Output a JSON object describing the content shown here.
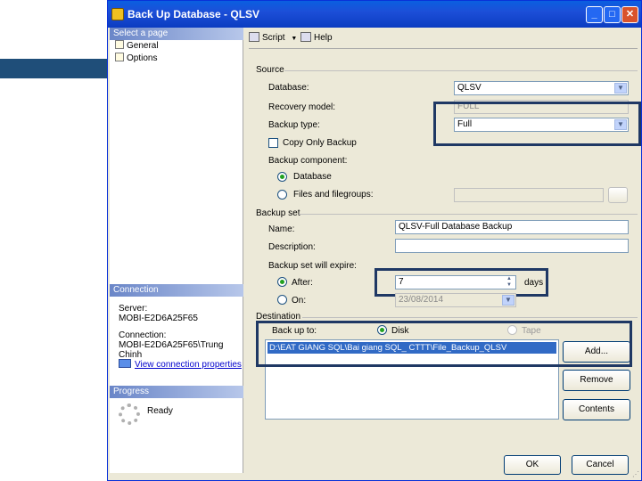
{
  "window": {
    "title": "Back Up Database - QLSV",
    "min_glyph": "_",
    "max_glyph": "□",
    "close_glyph": "✕"
  },
  "leftpanel": {
    "select_page": "Select a page",
    "pages": [
      "General",
      "Options"
    ],
    "connection_header": "Connection",
    "server_label": "Server:",
    "server_value": "MOBI-E2D6A25F65",
    "connection_label": "Connection:",
    "connection_value": "MOBI-E2D6A25F65\\Trung Chinh",
    "view_link": "View connection properties",
    "progress_header": "Progress",
    "progress_status": "Ready"
  },
  "toolbar": {
    "script": "Script",
    "script_caret": "▼",
    "help": "Help"
  },
  "source": {
    "heading": "Source",
    "database_label": "Database:",
    "database_value": "QLSV",
    "recovery_label": "Recovery model:",
    "recovery_value": "FULL",
    "backup_type_label": "Backup type:",
    "backup_type_value": "Full",
    "copy_only_label": "Copy Only Backup",
    "component_label": "Backup component:",
    "component_database": "Database",
    "component_files": "Files and filegroups:"
  },
  "backup_set": {
    "heading": "Backup set",
    "name_label": "Name:",
    "name_value": "QLSV-Full Database Backup",
    "description_label": "Description:",
    "description_value": "",
    "expire_label": "Backup set will expire:",
    "after_label": "After:",
    "after_value": "7",
    "after_unit": "days",
    "on_label": "On:",
    "on_value": "23/08/2014"
  },
  "destination": {
    "heading": "Destination",
    "backup_to_label": "Back up to:",
    "disk_label": "Disk",
    "tape_label": "Tape",
    "path": "D:\\EAT GIANG SQL\\Bai giang SQL_ CTTT\\File_Backup_QLSV",
    "add_button": "Add...",
    "remove_button": "Remove",
    "contents_button": "Contents"
  },
  "footer": {
    "ok_button": "OK",
    "cancel_button": "Cancel"
  },
  "colors": {
    "title_bar": "#0b3cc1",
    "highlight_box": "#1f3864",
    "panel_header": "#6a86c8"
  }
}
